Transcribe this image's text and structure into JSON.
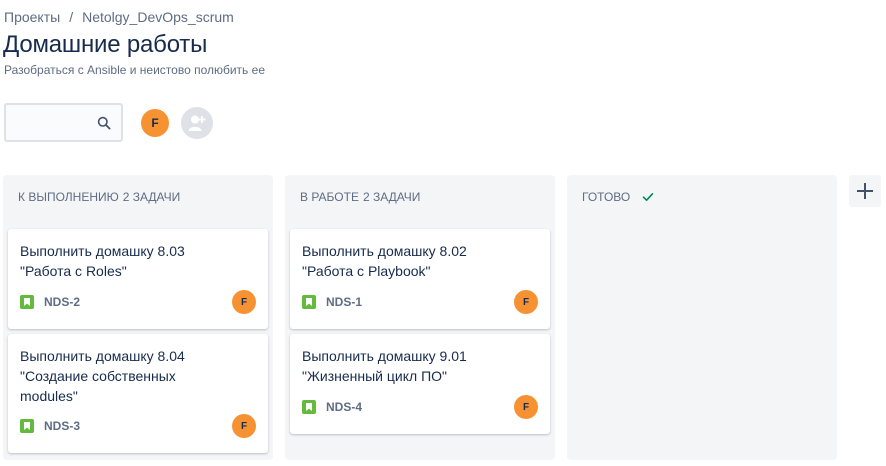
{
  "breadcrumb": {
    "items": [
      "Проекты",
      "Netolgy_DevOps_scrum"
    ],
    "separator": "/"
  },
  "page": {
    "title": "Домашние работы",
    "subtitle": "Разобраться с Ansible и неистово полюбить ее"
  },
  "toolbar": {
    "search_value": "",
    "search_icon": "search-icon",
    "user_initial": "F",
    "add_user_icon": "add-person-icon"
  },
  "columns": [
    {
      "title": "К выполнению",
      "count": "2 задачи",
      "cards": [
        {
          "summary": "Выполнить домашку 8.03\n\"Работа с Roles\"",
          "key": "NDS-2",
          "assignee": "F"
        },
        {
          "summary": "Выполнить домашку 8.04\n\"Создание собственных\nmodules\"",
          "key": "NDS-3",
          "assignee": "F"
        }
      ]
    },
    {
      "title": "В работе",
      "count": "2 задачи",
      "cards": [
        {
          "summary": "Выполнить домашку 8.02\n\"Работа с Playbook\"",
          "key": "NDS-1",
          "assignee": "F"
        },
        {
          "summary": "Выполнить домашку 9.01\n\"Жизненный цикл ПО\"",
          "key": "NDS-4",
          "assignee": "F"
        }
      ]
    },
    {
      "title": "Готово",
      "count": "",
      "done_icon": "check-icon",
      "cards": []
    }
  ],
  "colors": {
    "avatar": "#f79232",
    "story": "#63ba3c",
    "done_check": "#00875a",
    "column_bg": "#f4f5f7"
  }
}
